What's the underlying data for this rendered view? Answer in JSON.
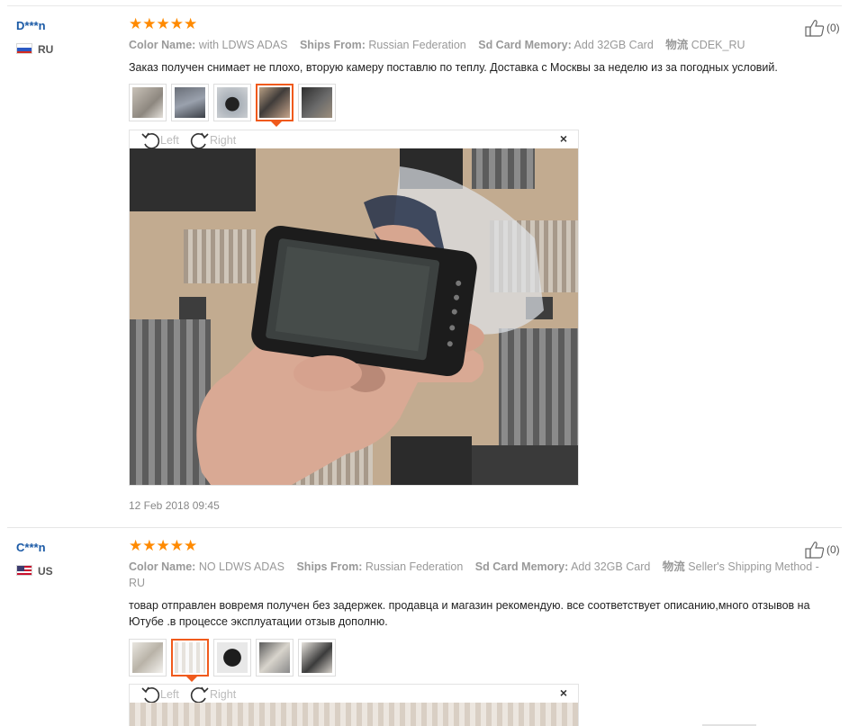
{
  "reviews": [
    {
      "user": "D***n",
      "country": "RU",
      "stars": "★★★★★",
      "likes": "(0)",
      "attrs": [
        {
          "key": "Color Name:",
          "value": "with LDWS ADAS"
        },
        {
          "key": "Ships From:",
          "value": "Russian Federation"
        },
        {
          "key": "Sd Card Memory:",
          "value": "Add 32GB Card"
        },
        {
          "key": "物流",
          "value": "CDEK_RU"
        }
      ],
      "text": "Заказ получен снимает не плохо, вторую камеру поставлю по теплу. Доставка с Москвы за неделю из за погодных условий.",
      "viewer": {
        "left_label": "Left",
        "right_label": "Right",
        "close": "×"
      },
      "date": "12 Feb 2018 09:45"
    },
    {
      "user": "C***n",
      "country": "US",
      "stars": "★★★★★",
      "likes": "(0)",
      "attrs": [
        {
          "key": "Color Name:",
          "value": "NO LDWS ADAS"
        },
        {
          "key": "Ships From:",
          "value": "Russian Federation"
        },
        {
          "key": "Sd Card Memory:",
          "value": "Add 32GB Card"
        },
        {
          "key": "物流",
          "value": "Seller's Shipping Method - RU"
        }
      ],
      "text": "товар отправлен вовремя получен без задержек. продавца и магазин рекомендую. все соответствует описанию,много отзывов на Ютубе .в процессе эксплуатации отзыв дополню.",
      "viewer": {
        "left_label": "Left",
        "right_label": "Right",
        "close": "×"
      }
    }
  ],
  "icons": {
    "like": "thumbs-up-icon",
    "rotate_left": "rotate-left-icon",
    "rotate_right": "rotate-right-icon",
    "close": "close-icon"
  },
  "colors": {
    "star": "#ff8a00",
    "username": "#1b5aa6",
    "active_thumb": "#f05a1c"
  }
}
